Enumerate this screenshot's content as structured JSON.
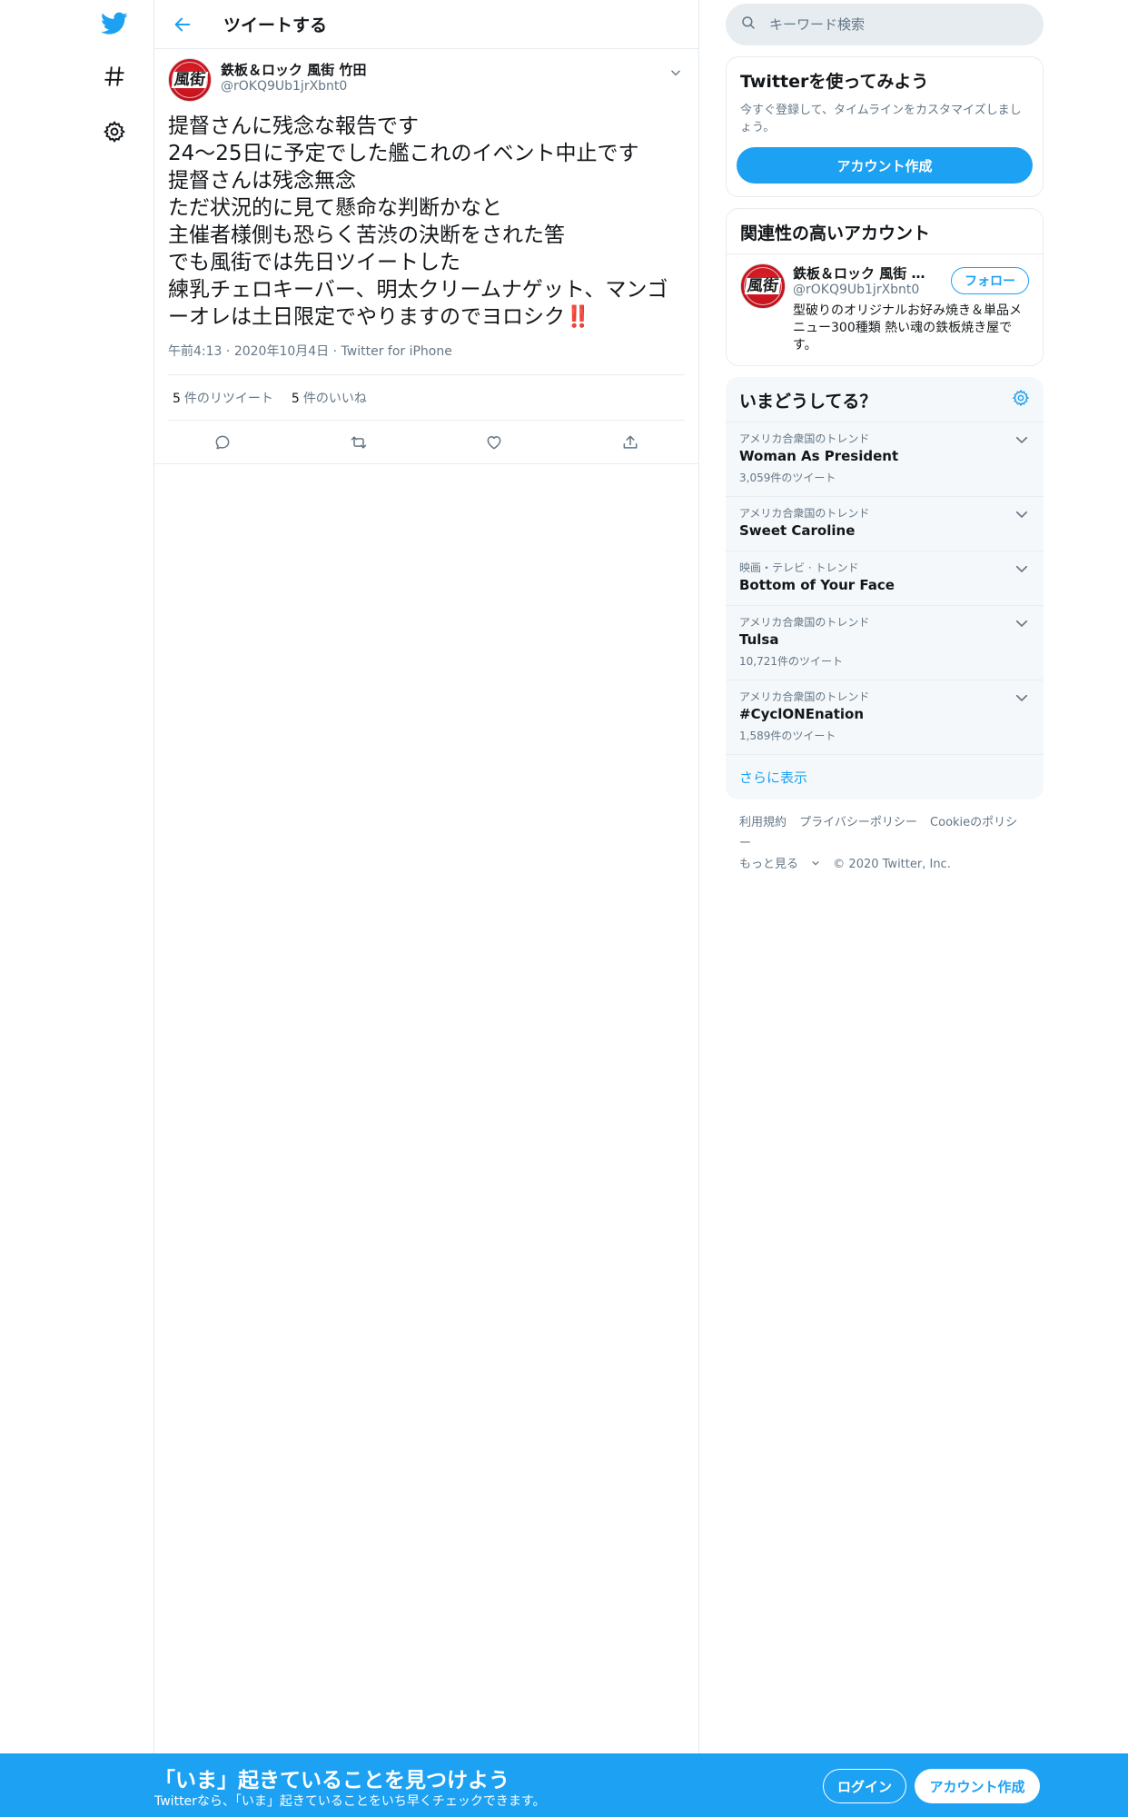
{
  "search": {
    "placeholder": "キーワード検索"
  },
  "header": {
    "title": "ツイートする"
  },
  "tweet": {
    "author_name": "鉄板＆ロック 風街 竹田",
    "author_handle": "@rOKQ9Ub1jrXbnt0",
    "avatar_text": "風街",
    "lines": [
      "提督さんに残念な報告です",
      "24〜25日に予定でした艦これのイベント中止です",
      "提督さんは残念無念",
      "ただ状況的に見て懸命な判断かなと",
      "主催者様側も恐らく苦渋の決断をされた筈",
      "でも風街では先日ツイートした",
      "練乳チェロキーバー、明太クリームナゲット、マンゴーオレは土日限定でやりますのでヨロシク"
    ],
    "emoji": "‼️",
    "time": "午前4:13",
    "date": "2020年10月4日",
    "source": "Twitter for iPhone",
    "retweet_count": "5",
    "retweet_label": "件のリツイート",
    "like_count": "5",
    "like_label": "件のいいね"
  },
  "signup_card": {
    "title": "Twitterを使ってみよう",
    "desc": "今すぐ登録して、タイムラインをカスタマイズしましょう。",
    "button": "アカウント作成"
  },
  "related": {
    "title": "関連性の高いアカウント",
    "name": "鉄板＆ロック 風街 竹田",
    "handle": "@rOKQ9Ub1jrXbnt0",
    "follow": "フォロー",
    "bio": "型破りのオリジナルお好み焼き＆単品メニュー300種類 熱い魂の鉄板焼き屋です。"
  },
  "trends": {
    "title": "いまどうしてる？",
    "items": [
      {
        "context": "アメリカ合衆国のトレンド",
        "name": "Woman As President",
        "count": "3,059件のツイート"
      },
      {
        "context": "アメリカ合衆国のトレンド",
        "name": "Sweet Caroline",
        "count": ""
      },
      {
        "context": "映画・テレビ · トレンド",
        "name": "Bottom of Your Face",
        "count": ""
      },
      {
        "context": "アメリカ合衆国のトレンド",
        "name": "Tulsa",
        "count": "10,721件のツイート"
      },
      {
        "context": "アメリカ合衆国のトレンド",
        "name": "#CyclONEnation",
        "count": "1,589件のツイート"
      }
    ],
    "more": "さらに表示"
  },
  "footer": {
    "terms": "利用規約",
    "privacy": "プライバシーポリシー",
    "cookie": "Cookieのポリシー",
    "more": "もっと見る",
    "copyright": "© 2020 Twitter, Inc."
  },
  "bottombar": {
    "title": "「いま」起きていることを見つけよう",
    "subtitle": "Twitterなら、「いま」起きていることをいち早くチェックできます。",
    "login": "ログイン",
    "signup": "アカウント作成"
  },
  "colors": {
    "accent": "#1da1f2",
    "text": "#14171a",
    "muted": "#657786",
    "border": "#e6ecf0"
  }
}
